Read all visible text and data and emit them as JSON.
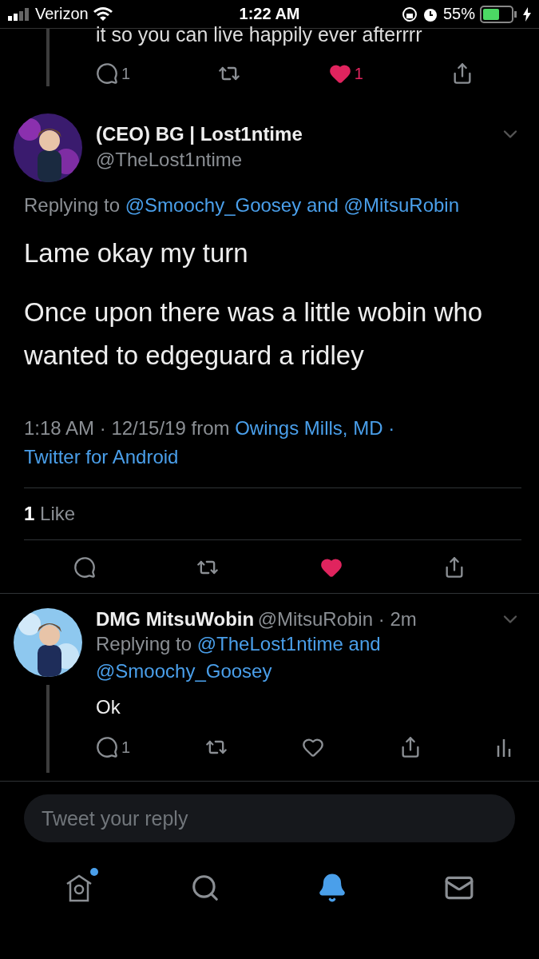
{
  "status_bar": {
    "carrier": "Verizon",
    "time": "1:22 AM",
    "battery": "55%"
  },
  "previous_tweet": {
    "text": "it so you can live happily ever afterrrr",
    "actions": [
      {
        "kind": "reply",
        "count": "1"
      },
      {
        "kind": "retweet"
      },
      {
        "kind": "like",
        "count": "1",
        "active": true
      },
      {
        "kind": "share"
      }
    ]
  },
  "main_tweet": {
    "name": "(CEO) BG | Lost1ntime",
    "handle": "@TheLost1ntime",
    "replying_prefix": "Replying to",
    "replying_mentions": [
      {
        "kind": "link",
        "text": "@Smoochy_Goosey"
      },
      {
        "kind": "link",
        "text": "and"
      },
      {
        "kind": "link",
        "text": "@MitsuRobin"
      }
    ],
    "paragraphs": [
      "Lame okay my turn",
      "Once upon there was a little wobin who wanted to edgeguard a ridley"
    ],
    "meta": [
      {
        "kind": "text",
        "text": "1:18 AM · 12/15/19 from"
      },
      {
        "kind": "link",
        "text": "Owings Mills, MD"
      },
      {
        "kind": "link",
        "text": "·"
      },
      {
        "kind": "link",
        "text": "Twitter for Android"
      }
    ],
    "likes_count": "1",
    "likes_label": "Like",
    "actions": [
      {
        "kind": "reply"
      },
      {
        "kind": "retweet"
      },
      {
        "kind": "like",
        "active": true
      },
      {
        "kind": "share"
      }
    ]
  },
  "reply_tweet": {
    "name": "DMG MitsuWobin",
    "handle_time": "@MitsuRobin · 2m",
    "replying_prefix": "Replying to",
    "replying_mentions": [
      {
        "kind": "link",
        "text": "@TheLost1ntime"
      },
      {
        "kind": "link",
        "text": "and"
      },
      {
        "kind": "link",
        "text": "@Smoochy_Goosey"
      }
    ],
    "text": "Ok",
    "actions": [
      {
        "kind": "reply",
        "count": "1"
      },
      {
        "kind": "retweet"
      },
      {
        "kind": "like",
        "active": false
      },
      {
        "kind": "share"
      },
      {
        "kind": "analytics"
      }
    ]
  },
  "reply_field": {
    "placeholder": "Tweet your reply"
  },
  "tabs": [
    {
      "kind": "home",
      "selected": false,
      "badge": true
    },
    {
      "kind": "search",
      "selected": false
    },
    {
      "kind": "notifications",
      "selected": true
    },
    {
      "kind": "messages",
      "selected": false
    }
  ]
}
